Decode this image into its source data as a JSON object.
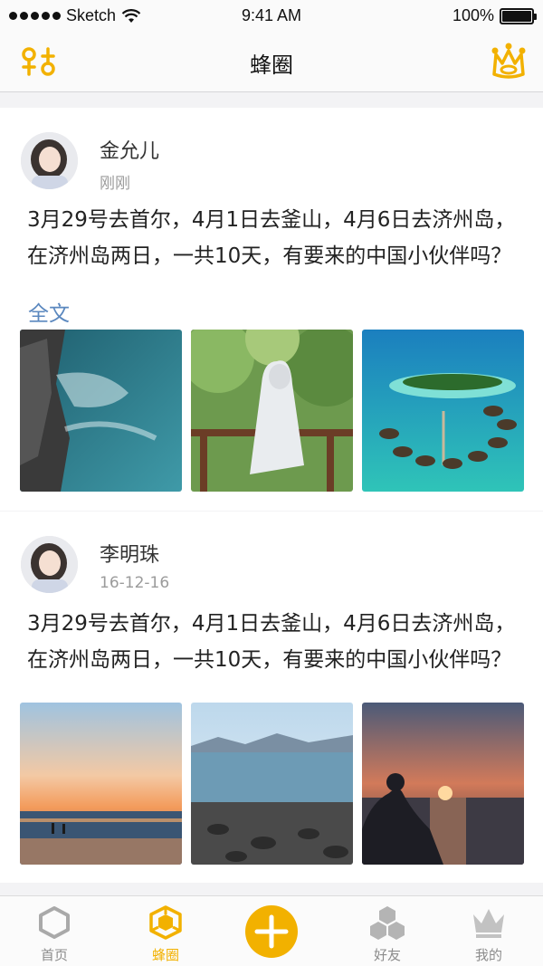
{
  "status_bar": {
    "carrier": "Sketch",
    "time": "9:41 AM",
    "battery": "100%"
  },
  "nav": {
    "title": "蜂圈",
    "left_icon": "filter-icon",
    "right_icon": "crown-icon"
  },
  "posts": [
    {
      "name": "金允儿",
      "time": "刚刚",
      "text": "3月29号去首尔，4月1日去釜山，4月6日去济州岛，在济州岛两日，一共10天，有要来的中国小伙伴吗？要么读书、要么旅行，灵魂和身体，必",
      "more_label": "全文",
      "photos": [
        "rocky-coast-photo",
        "girl-in-raincoat-photo",
        "island-resort-photo"
      ]
    },
    {
      "name": "李明珠",
      "time": "16-12-16",
      "text": "3月29号去首尔，4月1日去釜山，4月6日去济州岛，在济州岛两日，一共10天，有要来的中国小伙伴吗？",
      "photos": [
        "sunset-beach-photo",
        "pebble-shore-photo",
        "sunset-silhouette-photo"
      ]
    }
  ],
  "tab_bar": {
    "tabs": [
      {
        "label": "首页",
        "icon": "hexagon-icon",
        "active": false
      },
      {
        "label": "蜂圈",
        "icon": "honeycomb-icon",
        "active": true
      },
      {
        "label": "",
        "icon": "plus-icon",
        "active": false
      },
      {
        "label": "好友",
        "icon": "friends-icon",
        "active": false
      },
      {
        "label": "我的",
        "icon": "crown-icon",
        "active": false
      }
    ]
  },
  "colors": {
    "accent": "#f2b100",
    "link": "#5b88bf",
    "muted": "#9b9b9b",
    "background": "#f3f3f5"
  }
}
